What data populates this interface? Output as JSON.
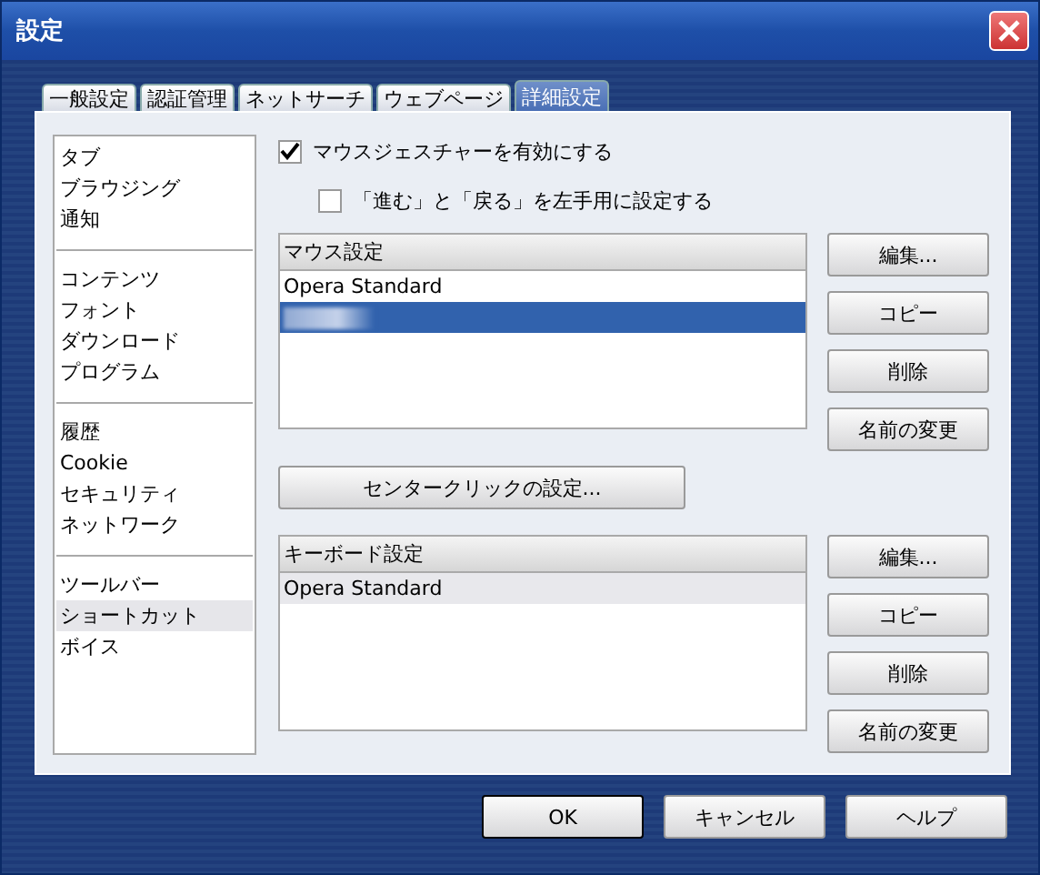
{
  "window": {
    "title": "設定"
  },
  "tabs": [
    {
      "label": "一般設定",
      "selected": false
    },
    {
      "label": "認証管理",
      "selected": false
    },
    {
      "label": "ネットサーチ",
      "selected": false
    },
    {
      "label": "ウェブページ",
      "selected": false
    },
    {
      "label": "詳細設定",
      "selected": true
    }
  ],
  "sidebar": {
    "groups": [
      {
        "items": [
          {
            "label": "タブ",
            "selected": false
          },
          {
            "label": "ブラウジング",
            "selected": false
          },
          {
            "label": "通知",
            "selected": false
          }
        ]
      },
      {
        "items": [
          {
            "label": "コンテンツ",
            "selected": false
          },
          {
            "label": "フォント",
            "selected": false
          },
          {
            "label": "ダウンロード",
            "selected": false
          },
          {
            "label": "プログラム",
            "selected": false
          }
        ]
      },
      {
        "items": [
          {
            "label": "履歴",
            "selected": false
          },
          {
            "label": "Cookie",
            "selected": false
          },
          {
            "label": "セキュリティ",
            "selected": false
          },
          {
            "label": "ネットワーク",
            "selected": false
          }
        ]
      },
      {
        "items": [
          {
            "label": "ツールバー",
            "selected": false
          },
          {
            "label": "ショートカット",
            "selected": true
          },
          {
            "label": "ボイス",
            "selected": false
          }
        ]
      }
    ]
  },
  "options": [
    {
      "label": "マウスジェスチャーを有効にする",
      "checked": true,
      "indented": false
    },
    {
      "label": "「進む」と「戻る」を左手用に設定する",
      "checked": false,
      "indented": true
    }
  ],
  "mouse_setup": {
    "header": "マウス設定",
    "focused": true,
    "items": [
      {
        "kind": "text",
        "label": "Opera Standard",
        "selected": false
      },
      {
        "kind": "redacted",
        "selected": true
      }
    ],
    "buttons": [
      "編集...",
      "コピー",
      "削除",
      "名前の変更"
    ]
  },
  "center_click_button": "センタークリックの設定...",
  "keyboard_setup": {
    "header": "キーボード設定",
    "focused": false,
    "items": [
      {
        "kind": "text",
        "label": "Opera Standard",
        "selected": true
      }
    ],
    "buttons": [
      "編集...",
      "コピー",
      "削除",
      "名前の変更"
    ]
  },
  "dialog_buttons": [
    {
      "label": "OK",
      "default": true
    },
    {
      "label": "キャンセル",
      "default": false
    },
    {
      "label": "ヘルプ",
      "default": false
    }
  ]
}
